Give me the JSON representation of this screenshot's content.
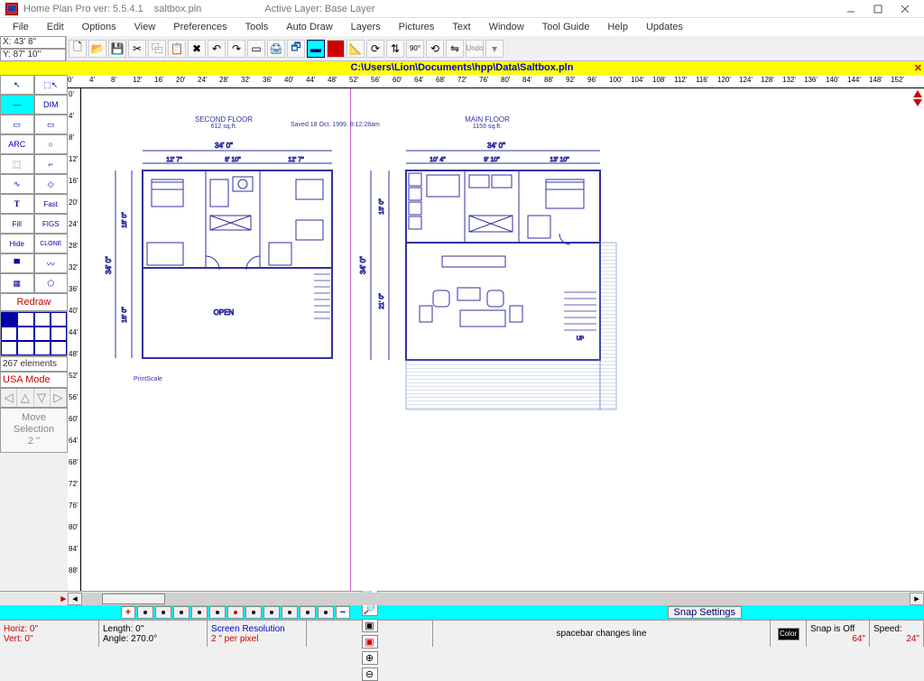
{
  "titlebar": {
    "app": "Home Plan Pro ver: 5.5.4.1",
    "file": "saltbox.pln",
    "active_layer": "Active Layer: Base Layer"
  },
  "menu": [
    "File",
    "Edit",
    "Options",
    "View",
    "Preferences",
    "Tools",
    "Auto Draw",
    "Layers",
    "Pictures",
    "Text",
    "Window",
    "Tool Guide",
    "Help",
    "Updates"
  ],
  "coords": {
    "x": "X: 43' 8\"",
    "y": "Y: 87' 10\""
  },
  "pathbar": "C:\\Users\\Lion\\Documents\\hpp\\Data\\Saltbox.pln",
  "hruler_ticks": [
    "0'",
    "4'",
    "8'",
    "12'",
    "16'",
    "20'",
    "24'",
    "28'",
    "32'",
    "36'",
    "40'",
    "44'",
    "48'",
    "52'",
    "56'",
    "60'",
    "64'",
    "68'",
    "72'",
    "76'",
    "80'",
    "84'",
    "88'",
    "92'",
    "96'",
    "100'",
    "104'",
    "108'",
    "112'",
    "116'",
    "120'",
    "124'",
    "128'",
    "132'",
    "136'",
    "140'",
    "144'",
    "148'",
    "152'"
  ],
  "vruler_ticks": [
    "0'",
    "4'",
    "8'",
    "12'",
    "16'",
    "20'",
    "24'",
    "28'",
    "32'",
    "36'",
    "40'",
    "44'",
    "48'",
    "52'",
    "56'",
    "60'",
    "64'",
    "68'",
    "72'",
    "76'",
    "80'",
    "84'",
    "88'"
  ],
  "floor_second": {
    "title": "SECOND FLOOR",
    "sqft": "612 sq.ft.",
    "width_dim": "34' 0\"",
    "sub_dims": [
      "12' 7\"",
      "8' 10\"",
      "12' 7\""
    ],
    "height_dim": "34' 0\"",
    "sub_heights": [
      "18' 0\"",
      "16' 0\""
    ],
    "open_label": "OPEN",
    "printscale": "PrintScale"
  },
  "floor_main": {
    "title": "MAIN FLOOR",
    "sqft": "1156 sq.ft.",
    "width_dim": "34' 0\"",
    "sub_dims": [
      "10' 4\"",
      "9' 10\"",
      "13' 10\""
    ],
    "height_dim": "34' 0\"",
    "sub_heights": [
      "13' 0\"",
      "21' 0\""
    ],
    "up": "UP"
  },
  "save_note": "Saved 18 Oct. 1999. 8:12:28am",
  "redraw": "Redraw",
  "elements": "267 elements",
  "usa": "USA Mode",
  "move_sel": {
    "l1": "Move",
    "l2": "Selection",
    "l3": "2 \""
  },
  "snap_settings": "Snap Settings",
  "status": {
    "horiz": "Horiz: 0\"",
    "vert": "Vert:  0\"",
    "length": "Length:  0\"",
    "angle": "Angle: 270.0°",
    "screen_res": "Screen Resolution",
    "per_pixel": "2 \" per pixel",
    "hint": "spacebar changes line",
    "color": "Color",
    "snap": "Snap is Off",
    "snap_val": "64\"",
    "speed": "Speed:",
    "speed_val": "24\""
  },
  "tool_labels": {
    "dim": "DIM",
    "arc": "ARC",
    "t": "T",
    "fast": "Fast",
    "fill": "Fill",
    "figs": "FIGS",
    "hide": "Hide",
    "clone": "CLONE",
    "undo": "Undo"
  }
}
